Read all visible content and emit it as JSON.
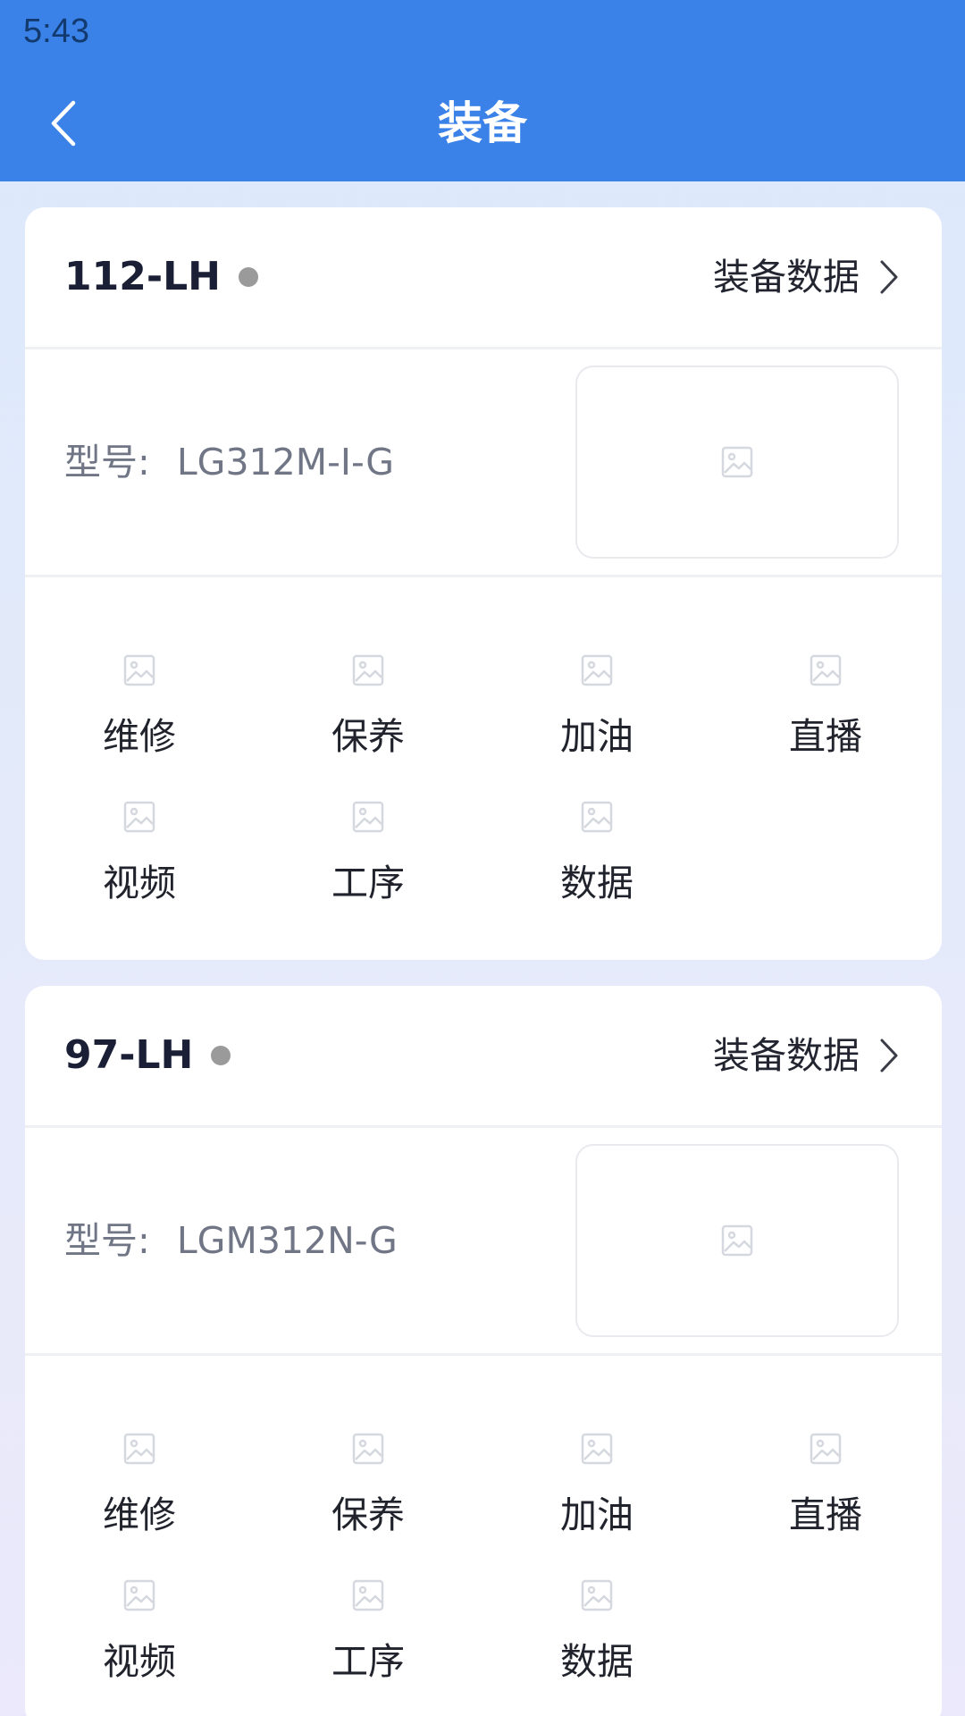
{
  "status_bar": {
    "time": "5:43"
  },
  "header": {
    "title": "装备",
    "back_icon": "chevron-left-icon"
  },
  "colors": {
    "header_bg": "#3b82e8",
    "status_dot": "#9a9a9a"
  },
  "cards": [
    {
      "name": "112-LH",
      "link_label": "装备数据",
      "model_label": "型号:",
      "model_value": "LG312M-I-G",
      "actions": [
        {
          "label": "维修"
        },
        {
          "label": "保养"
        },
        {
          "label": "加油"
        },
        {
          "label": "直播"
        },
        {
          "label": "视频"
        },
        {
          "label": "工序"
        },
        {
          "label": "数据"
        }
      ]
    },
    {
      "name": "97-LH",
      "link_label": "装备数据",
      "model_label": "型号:",
      "model_value": "LGM312N-G",
      "actions": [
        {
          "label": "维修"
        },
        {
          "label": "保养"
        },
        {
          "label": "加油"
        },
        {
          "label": "直播"
        },
        {
          "label": "视频"
        },
        {
          "label": "工序"
        },
        {
          "label": "数据"
        }
      ]
    }
  ]
}
